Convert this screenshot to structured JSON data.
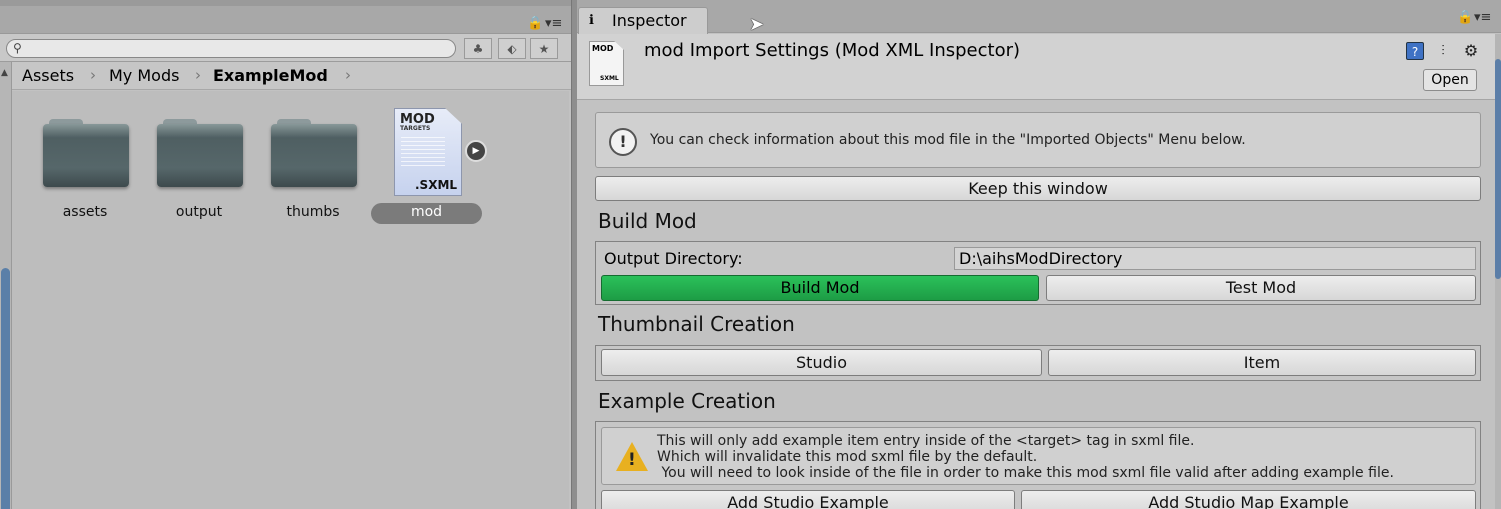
{
  "project": {
    "breadcrumb": [
      "Assets",
      "My Mods",
      "ExampleMod"
    ],
    "search_placeholder": "",
    "assets": [
      {
        "name": "assets",
        "kind": "folder"
      },
      {
        "name": "output",
        "kind": "folder"
      },
      {
        "name": "thumbs",
        "kind": "folder"
      },
      {
        "name": "mod",
        "kind": "sxml",
        "selected": true
      }
    ],
    "sxml_icon_text": {
      "top": "MOD",
      "sub": "TARGETS",
      "ext": ".SXML"
    }
  },
  "inspector": {
    "tab_label": "Inspector",
    "title": "mod Import Settings (Mod XML Inspector)",
    "header_icon_text": {
      "top": "MOD",
      "ext": "SXML"
    },
    "open_label": "Open",
    "info_text": "You can check information about this mod file in the \"Imported Objects\" Menu below.",
    "keep_label": "Keep this window",
    "build": {
      "title": "Build Mod",
      "output_label": "Output Directory:",
      "output_value": "D:\\aihsModDirectory",
      "build_label": "Build Mod",
      "test_label": "Test Mod"
    },
    "thumbnail": {
      "title": "Thumbnail Creation",
      "studio_label": "Studio",
      "item_label": "Item"
    },
    "example": {
      "title": "Example Creation",
      "warning_lines": [
        "This will only add example item entry inside of the <target> tag in sxml file.",
        "Which will invalidate this mod sxml file by the default.",
        " You will need to look inside of the file in order to make this mod sxml file valid after adding example file."
      ],
      "add_studio_label": "Add Studio Example",
      "add_map_label": "Add Studio Map Example"
    }
  },
  "colors": {
    "build_button": "#22b14c",
    "scroll_thumb": "#5a7fa8"
  }
}
